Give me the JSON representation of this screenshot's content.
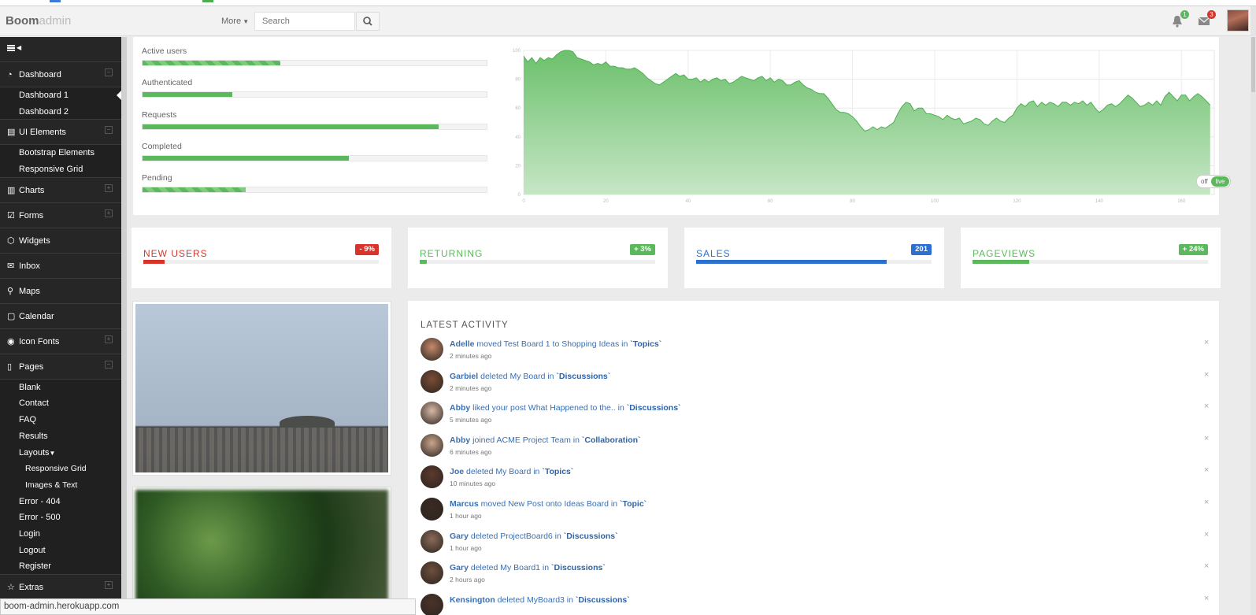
{
  "brand": {
    "strong": "Boom",
    "thin": "admin"
  },
  "header": {
    "more_label": "More",
    "search_placeholder": "Search",
    "notifications_count": "1",
    "messages_count": "3"
  },
  "sidebar": {
    "sections": [
      {
        "label": "Dashboard",
        "icon": "dashboard-icon",
        "items": [
          "Dashboard 1",
          "Dashboard 2"
        ]
      },
      {
        "label": "UI Elements",
        "icon": "ui-elements-icon",
        "items": [
          "Bootstrap Elements",
          "Responsive Grid"
        ]
      },
      {
        "label": "Charts",
        "icon": "charts-icon",
        "items": []
      },
      {
        "label": "Forms",
        "icon": "forms-icon",
        "items": []
      },
      {
        "label": "Widgets",
        "icon": "widgets-icon",
        "items": []
      },
      {
        "label": "Inbox",
        "icon": "inbox-icon",
        "items": []
      },
      {
        "label": "Maps",
        "icon": "map-pin-icon",
        "items": []
      },
      {
        "label": "Calendar",
        "icon": "calendar-icon",
        "items": []
      },
      {
        "label": "Icon Fonts",
        "icon": "eye-icon",
        "items": []
      },
      {
        "label": "Pages",
        "icon": "pages-icon",
        "items": [
          "Blank",
          "Contact",
          "FAQ",
          "Results",
          "Layouts",
          "Responsive Grid",
          "Images & Text",
          "Error - 404",
          "Error - 500",
          "Login",
          "Logout",
          "Register"
        ]
      },
      {
        "label": "Extras",
        "icon": "star-icon",
        "items": []
      }
    ]
  },
  "stats": [
    {
      "label": "Active users",
      "percent": 40,
      "striped": true
    },
    {
      "label": "Authenticated",
      "percent": 26,
      "striped": false
    },
    {
      "label": "Requests",
      "percent": 86,
      "striped": false
    },
    {
      "label": "Completed",
      "percent": 60,
      "striped": false
    },
    {
      "label": "Pending",
      "percent": 30,
      "striped": true
    }
  ],
  "chart_data": {
    "type": "area",
    "xlim": [
      0,
      168
    ],
    "ylim": [
      0,
      100
    ],
    "x_ticks": [
      0,
      20,
      40,
      60,
      80,
      100,
      120,
      140,
      160
    ],
    "y_ticks": [
      0,
      20,
      40,
      60,
      80,
      100
    ],
    "values": [
      96,
      92,
      95,
      91,
      95,
      93,
      95,
      94,
      97,
      99,
      100,
      100,
      99,
      95,
      94,
      93,
      92,
      90,
      91,
      90,
      92,
      89,
      89,
      88,
      88,
      87,
      87,
      88,
      86,
      84,
      81,
      79,
      77,
      76,
      78,
      80,
      82,
      84,
      82,
      83,
      80,
      80,
      81,
      78,
      80,
      78,
      80,
      81,
      79,
      80,
      77,
      78,
      80,
      82,
      81,
      80,
      79,
      81,
      82,
      79,
      81,
      78,
      80,
      79,
      76,
      76,
      78,
      79,
      76,
      74,
      73,
      71,
      70,
      70,
      67,
      63,
      59,
      57,
      57,
      56,
      54,
      51,
      47,
      44,
      45,
      47,
      45,
      47,
      46,
      48,
      50,
      56,
      61,
      64,
      63,
      58,
      60,
      60,
      56,
      56,
      55,
      54,
      52,
      55,
      53,
      52,
      53,
      49,
      50,
      51,
      53,
      52,
      49,
      48,
      51,
      53,
      51,
      50,
      53,
      55,
      60,
      63,
      61,
      64,
      65,
      61,
      64,
      62,
      64,
      63,
      61,
      64,
      64,
      62,
      64,
      63,
      65,
      62,
      64,
      60,
      57,
      59,
      62,
      63,
      61,
      63,
      66,
      69,
      67,
      64,
      61,
      62,
      64,
      62,
      65,
      62,
      68,
      71,
      68,
      65,
      69,
      69,
      65,
      68,
      70,
      68,
      65,
      62
    ],
    "toggle": {
      "off": "off",
      "on": "live"
    },
    "colors": {
      "fill": "#6cc06c",
      "fill_bottom": "#c6e6c6",
      "line": "#4caf50"
    }
  },
  "kpis": [
    {
      "title": "NEW USERS",
      "badge": "- 9%",
      "percent": 9,
      "color": "#d9342b"
    },
    {
      "title": "RETURNING",
      "badge": "+ 3%",
      "percent": 3,
      "color": "#5cb85c"
    },
    {
      "title": "SALES",
      "badge": "201",
      "percent": 81,
      "color": "#2b6fd0"
    },
    {
      "title": "PAGEVIEWS",
      "badge": "+ 24%",
      "percent": 24,
      "color": "#5cb85c"
    }
  ],
  "activity": {
    "title": "LATEST ACTIVITY",
    "items": [
      {
        "name": "Adelle",
        "action": " moved Test Board 1 to Shopping Ideas in ",
        "target": "`Topics`",
        "time": "2 minutes ago"
      },
      {
        "name": "Garbiel",
        "action": " deleted My Board in ",
        "target": "`Discussions`",
        "time": "2 minutes ago"
      },
      {
        "name": "Abby",
        "action": " liked your post What Happened to the.. in ",
        "target": "`Discussions`",
        "time": "5 minutes ago"
      },
      {
        "name": "Abby",
        "action": " joined ACME Project Team in ",
        "target": "`Collaboration`",
        "time": "6 minutes ago"
      },
      {
        "name": "Joe",
        "action": " deleted My Board in ",
        "target": "`Topics`",
        "time": "10 minutes ago"
      },
      {
        "name": "Marcus",
        "action": " moved New Post onto Ideas Board in ",
        "target": "`Topic`",
        "time": "1 hour ago"
      },
      {
        "name": "Gary",
        "action": " deleted ProjectBoard6 in ",
        "target": "`Discussions`",
        "time": "1 hour ago"
      },
      {
        "name": "Gary",
        "action": " deleted My Board1 in ",
        "target": "`Discussions`",
        "time": "2 hours ago"
      },
      {
        "name": "Kensington",
        "action": " deleted MyBoard3 in ",
        "target": "`Discussions`",
        "time": ""
      }
    ]
  },
  "status_url": "boom-admin.herokuapp.com"
}
